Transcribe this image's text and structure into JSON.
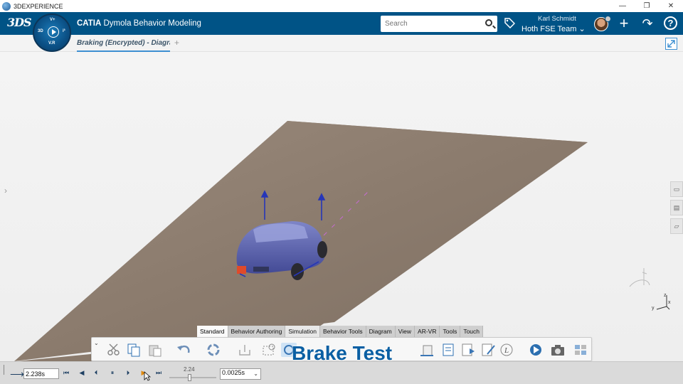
{
  "window": {
    "title": "3DEXPERIENCE",
    "controls": {
      "minimize": "—",
      "restore": "❐",
      "close": "✕"
    }
  },
  "topbar": {
    "logo": "3DS",
    "app_brand": "CATIA",
    "app_name": "Dymola Behavior Modeling",
    "compass_labels": {
      "top": "V+",
      "left": "3D",
      "right": "i³",
      "bottom": "V.R"
    },
    "search_placeholder": "Search",
    "user_name": "Karl Schmidt",
    "team": "Hoth FSE Team",
    "team_chevron": "⌄",
    "add_icon": "+",
    "share_icon": "↷",
    "help_icon": "?",
    "brand_color": "#005386"
  },
  "tabbar": {
    "tab_label": "Braking (Encrypted) - Diagram",
    "add_tab": "+"
  },
  "viewport": {
    "left_arrow": "›",
    "ground_color": "#8b7b6d",
    "vehicle_color": "#5a64b8"
  },
  "action_bar": {
    "tabs": [
      "Standard",
      "Behavior Authoring",
      "Simulation",
      "Behavior Tools",
      "Diagram",
      "View",
      "AR-VR",
      "Tools",
      "Touch"
    ],
    "active_tab": "Standard",
    "handle": "⌄"
  },
  "caption": "Brake Test",
  "player": {
    "arrow": "⟶",
    "current_time": "2.238s",
    "slider_value": "2.24",
    "step": "0.0025s",
    "buttons": {
      "first": "⏮",
      "prev": "◀",
      "back": "⏴",
      "pause": "⏸",
      "fwd": "⏵",
      "play": "▶",
      "last": "⏭"
    }
  }
}
